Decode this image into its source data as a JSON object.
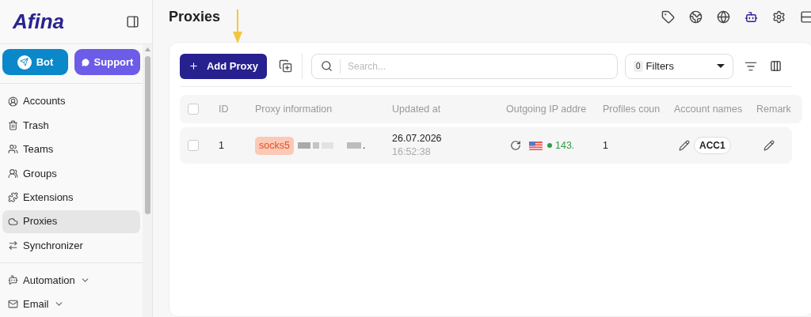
{
  "sidebar": {
    "logo": "Afina",
    "buttons": [
      {
        "label": "Bot",
        "kind": "telegram"
      },
      {
        "label": "Support",
        "kind": "discord"
      }
    ],
    "items": [
      {
        "label": "Accounts",
        "selected": false
      },
      {
        "label": "Trash",
        "selected": false
      },
      {
        "label": "Teams",
        "selected": false
      },
      {
        "label": "Groups",
        "selected": false
      },
      {
        "label": "Extensions",
        "selected": false
      },
      {
        "label": "Proxies",
        "selected": true
      },
      {
        "label": "Synchronizer",
        "selected": false
      }
    ],
    "sections": [
      {
        "label": "Automation",
        "expanded": false
      },
      {
        "label": "Email",
        "expanded": false
      }
    ]
  },
  "page": {
    "title": "Proxies"
  },
  "toolbar": {
    "add_button": "Add Proxy",
    "search": {
      "placeholder": "Search..."
    },
    "filters": {
      "count": "0",
      "label": "Filters"
    }
  },
  "table": {
    "all_selected": false,
    "columns": [
      "ID",
      "Proxy information",
      "Updated at",
      "Outgoing IP addre",
      "Profiles coun",
      "Account names",
      "Remark"
    ],
    "rows": [
      {
        "selected": false,
        "id": "1",
        "protocol": "socks5",
        "suffix": ".",
        "date": "26.07.2026",
        "time": "16:52:38",
        "ip": "143.",
        "ip_online": true,
        "profiles": "1",
        "account": "ACC1"
      }
    ]
  }
}
